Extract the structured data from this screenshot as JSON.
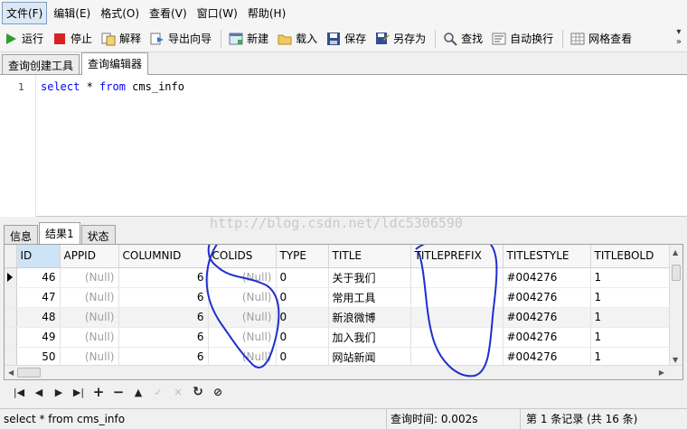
{
  "menu": [
    "文件(F)",
    "编辑(E)",
    "格式(O)",
    "查看(V)",
    "窗口(W)",
    "帮助(H)"
  ],
  "toolbar": {
    "run": "运行",
    "stop": "停止",
    "explain": "解释",
    "export_wizard": "导出向导",
    "new": "新建",
    "load": "载入",
    "save": "保存",
    "save_as": "另存为",
    "find": "查找",
    "word_wrap": "自动换行",
    "grid_view": "网格查看"
  },
  "editor_tabs": [
    "查询创建工具",
    "查询编辑器"
  ],
  "editor": {
    "line_number": "1",
    "kw_select": "select",
    "star": " * ",
    "kw_from": "from",
    "table": " cms_info"
  },
  "result_tabs": [
    "信息",
    "结果1",
    "状态"
  ],
  "watermark": "http://blog.csdn.net/ldc5306590",
  "grid": {
    "columns": [
      "ID",
      "APPID",
      "COLUMNID",
      "COLIDS",
      "TYPE",
      "TITLE",
      "TITLEPREFIX",
      "TITLESTYLE",
      "TITLEBOLD"
    ],
    "rows": [
      [
        "46",
        "(Null)",
        "6",
        "(Null)",
        "0",
        "关于我们",
        "",
        "#004276",
        "1"
      ],
      [
        "47",
        "(Null)",
        "6",
        "(Null)",
        "0",
        "常用工具",
        "",
        "#004276",
        "1"
      ],
      [
        "48",
        "(Null)",
        "6",
        "(Null)",
        "0",
        "新浪微博",
        "",
        "#004276",
        "1"
      ],
      [
        "49",
        "(Null)",
        "6",
        "(Null)",
        "0",
        "加入我们",
        "",
        "#004276",
        "1"
      ],
      [
        "50",
        "(Null)",
        "6",
        "(Null)",
        "0",
        "网站新闻",
        "",
        "#004276",
        "1"
      ]
    ]
  },
  "navigation": [
    "first-record",
    "prev-record",
    "next-record",
    "last-record",
    "add-record",
    "delete-record",
    "up",
    "apply",
    "cancel",
    "refresh",
    "stop"
  ],
  "status": {
    "sql": "select * from cms_info",
    "query_time": "查询时间: 0.002s",
    "record_info": "第 1 条记录 (共 16 条)"
  },
  "colors": {
    "keyword": "#0000ff",
    "annotation": "#1f2fd0",
    "null_text": "#a0a0a0"
  }
}
